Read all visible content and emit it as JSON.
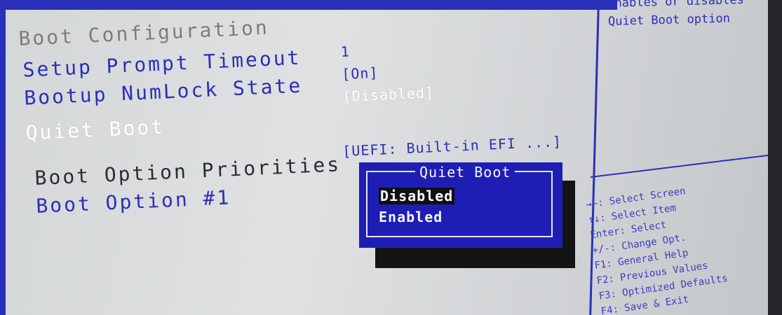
{
  "section_title": "Boot Configuration",
  "settings": [
    {
      "label": "Setup Prompt Timeout",
      "value": "1"
    },
    {
      "label": "Bootup NumLock State",
      "value": "[On]"
    },
    {
      "label": "Quiet Boot",
      "value": "[Disabled]"
    }
  ],
  "priorities": {
    "heading": "Boot Option Priorities",
    "option1_label": "Boot Option #1",
    "option1_value": "[UEFI: Built-in EFI ...]"
  },
  "popup": {
    "title": "Quiet Boot",
    "options": [
      "Disabled",
      "Enabled"
    ],
    "selected": "Disabled"
  },
  "help": {
    "lines": [
      "Enables or disables",
      "Quiet Boot option"
    ]
  },
  "key_help": [
    "→←: Select Screen",
    "↑↓: Select Item",
    "Enter: Select",
    "+/-: Change Opt.",
    "F1: General Help",
    "F2: Previous Values",
    "F3: Optimized Defaults",
    "F4: Save & Exit"
  ],
  "colors": {
    "bios_blue": "#2a2fb8",
    "background": "#d4d7d8",
    "popup_blue": "#1e1eb4"
  }
}
